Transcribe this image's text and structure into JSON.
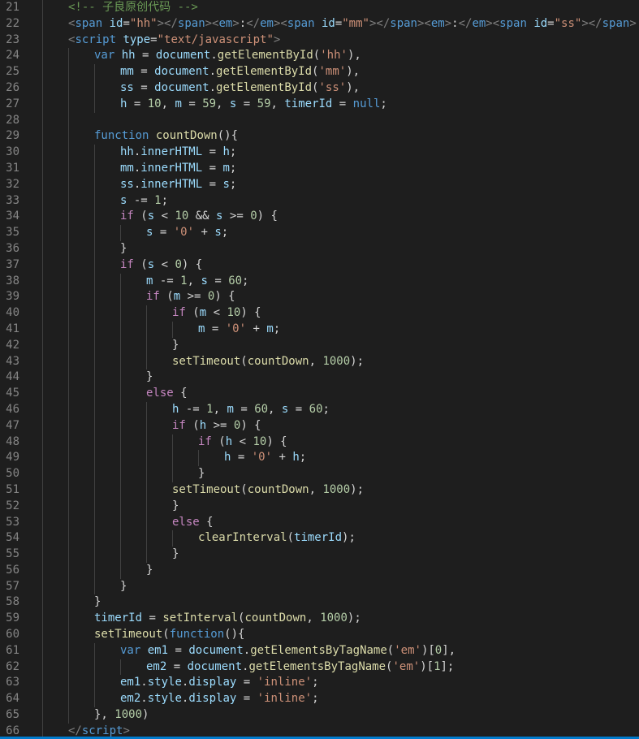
{
  "colors": {
    "plain": "#d4d4d4",
    "keyword": "#569cd6",
    "control": "#c586c0",
    "identifier": "#9cdcfe",
    "function": "#dcdcaa",
    "string": "#ce9178",
    "number": "#b5cea8",
    "comment": "#6a9955",
    "tag": "#569cd6",
    "bracket": "#808080",
    "attr": "#9cdcfe"
  },
  "lines": [
    {
      "n": "21",
      "indent": 1,
      "tokens": [
        [
          "comment",
          "<!-- 子良原创代码 -->"
        ]
      ]
    },
    {
      "n": "22",
      "indent": 1,
      "tokens": [
        [
          "bracket",
          "<"
        ],
        [
          "tag",
          "span"
        ],
        [
          "plain",
          " "
        ],
        [
          "attr",
          "id"
        ],
        [
          "plain",
          "="
        ],
        [
          "string",
          "\"hh\""
        ],
        [
          "bracket",
          "></"
        ],
        [
          "tag",
          "span"
        ],
        [
          "bracket",
          "><"
        ],
        [
          "tag",
          "em"
        ],
        [
          "bracket",
          ">"
        ],
        [
          "plain",
          ":"
        ],
        [
          "bracket",
          "</"
        ],
        [
          "tag",
          "em"
        ],
        [
          "bracket",
          "><"
        ],
        [
          "tag",
          "span"
        ],
        [
          "plain",
          " "
        ],
        [
          "attr",
          "id"
        ],
        [
          "plain",
          "="
        ],
        [
          "string",
          "\"mm\""
        ],
        [
          "bracket",
          "></"
        ],
        [
          "tag",
          "span"
        ],
        [
          "bracket",
          "><"
        ],
        [
          "tag",
          "em"
        ],
        [
          "bracket",
          ">"
        ],
        [
          "plain",
          ":"
        ],
        [
          "bracket",
          "</"
        ],
        [
          "tag",
          "em"
        ],
        [
          "bracket",
          "><"
        ],
        [
          "tag",
          "span"
        ],
        [
          "plain",
          " "
        ],
        [
          "attr",
          "id"
        ],
        [
          "plain",
          "="
        ],
        [
          "string",
          "\"ss\""
        ],
        [
          "bracket",
          "></"
        ],
        [
          "tag",
          "span"
        ],
        [
          "bracket",
          ">"
        ]
      ]
    },
    {
      "n": "23",
      "indent": 1,
      "tokens": [
        [
          "bracket",
          "<"
        ],
        [
          "tag",
          "script"
        ],
        [
          "plain",
          " "
        ],
        [
          "attr",
          "type"
        ],
        [
          "plain",
          "="
        ],
        [
          "string",
          "\"text/javascript\""
        ],
        [
          "bracket",
          ">"
        ]
      ]
    },
    {
      "n": "24",
      "indent": 2,
      "tokens": [
        [
          "keyword",
          "var"
        ],
        [
          "plain",
          " "
        ],
        [
          "identifier",
          "hh"
        ],
        [
          "plain",
          " = "
        ],
        [
          "identifier",
          "document"
        ],
        [
          "plain",
          "."
        ],
        [
          "function",
          "getElementById"
        ],
        [
          "plain",
          "("
        ],
        [
          "string",
          "'hh'"
        ],
        [
          "plain",
          "),"
        ]
      ]
    },
    {
      "n": "25",
      "indent": 3,
      "tokens": [
        [
          "identifier",
          "mm"
        ],
        [
          "plain",
          " = "
        ],
        [
          "identifier",
          "document"
        ],
        [
          "plain",
          "."
        ],
        [
          "function",
          "getElementById"
        ],
        [
          "plain",
          "("
        ],
        [
          "string",
          "'mm'"
        ],
        [
          "plain",
          "),"
        ]
      ]
    },
    {
      "n": "26",
      "indent": 3,
      "tokens": [
        [
          "identifier",
          "ss"
        ],
        [
          "plain",
          " = "
        ],
        [
          "identifier",
          "document"
        ],
        [
          "plain",
          "."
        ],
        [
          "function",
          "getElementById"
        ],
        [
          "plain",
          "("
        ],
        [
          "string",
          "'ss'"
        ],
        [
          "plain",
          "),"
        ]
      ]
    },
    {
      "n": "27",
      "indent": 3,
      "tokens": [
        [
          "identifier",
          "h"
        ],
        [
          "plain",
          " = "
        ],
        [
          "number",
          "10"
        ],
        [
          "plain",
          ", "
        ],
        [
          "identifier",
          "m"
        ],
        [
          "plain",
          " = "
        ],
        [
          "number",
          "59"
        ],
        [
          "plain",
          ", "
        ],
        [
          "identifier",
          "s"
        ],
        [
          "plain",
          " = "
        ],
        [
          "number",
          "59"
        ],
        [
          "plain",
          ", "
        ],
        [
          "identifier",
          "timerId"
        ],
        [
          "plain",
          " = "
        ],
        [
          "keyword",
          "null"
        ],
        [
          "plain",
          ";"
        ]
      ]
    },
    {
      "n": "28",
      "indent": 2,
      "tokens": []
    },
    {
      "n": "29",
      "indent": 2,
      "tokens": [
        [
          "keyword",
          "function"
        ],
        [
          "plain",
          " "
        ],
        [
          "function",
          "countDown"
        ],
        [
          "plain",
          "(){"
        ]
      ]
    },
    {
      "n": "30",
      "indent": 3,
      "tokens": [
        [
          "identifier",
          "hh"
        ],
        [
          "plain",
          "."
        ],
        [
          "identifier",
          "innerHTML"
        ],
        [
          "plain",
          " = "
        ],
        [
          "identifier",
          "h"
        ],
        [
          "plain",
          ";"
        ]
      ]
    },
    {
      "n": "31",
      "indent": 3,
      "tokens": [
        [
          "identifier",
          "mm"
        ],
        [
          "plain",
          "."
        ],
        [
          "identifier",
          "innerHTML"
        ],
        [
          "plain",
          " = "
        ],
        [
          "identifier",
          "m"
        ],
        [
          "plain",
          ";"
        ]
      ]
    },
    {
      "n": "32",
      "indent": 3,
      "tokens": [
        [
          "identifier",
          "ss"
        ],
        [
          "plain",
          "."
        ],
        [
          "identifier",
          "innerHTML"
        ],
        [
          "plain",
          " = "
        ],
        [
          "identifier",
          "s"
        ],
        [
          "plain",
          ";"
        ]
      ]
    },
    {
      "n": "33",
      "indent": 3,
      "tokens": [
        [
          "identifier",
          "s"
        ],
        [
          "plain",
          " -= "
        ],
        [
          "number",
          "1"
        ],
        [
          "plain",
          ";"
        ]
      ]
    },
    {
      "n": "34",
      "indent": 3,
      "tokens": [
        [
          "control",
          "if"
        ],
        [
          "plain",
          " ("
        ],
        [
          "identifier",
          "s"
        ],
        [
          "plain",
          " < "
        ],
        [
          "number",
          "10"
        ],
        [
          "plain",
          " && "
        ],
        [
          "identifier",
          "s"
        ],
        [
          "plain",
          " >= "
        ],
        [
          "number",
          "0"
        ],
        [
          "plain",
          ") {"
        ]
      ]
    },
    {
      "n": "35",
      "indent": 4,
      "tokens": [
        [
          "identifier",
          "s"
        ],
        [
          "plain",
          " = "
        ],
        [
          "string",
          "'0'"
        ],
        [
          "plain",
          " + "
        ],
        [
          "identifier",
          "s"
        ],
        [
          "plain",
          ";"
        ]
      ]
    },
    {
      "n": "36",
      "indent": 3,
      "tokens": [
        [
          "plain",
          "}"
        ]
      ]
    },
    {
      "n": "37",
      "indent": 3,
      "tokens": [
        [
          "control",
          "if"
        ],
        [
          "plain",
          " ("
        ],
        [
          "identifier",
          "s"
        ],
        [
          "plain",
          " < "
        ],
        [
          "number",
          "0"
        ],
        [
          "plain",
          ") {"
        ]
      ]
    },
    {
      "n": "38",
      "indent": 4,
      "tokens": [
        [
          "identifier",
          "m"
        ],
        [
          "plain",
          " -= "
        ],
        [
          "number",
          "1"
        ],
        [
          "plain",
          ", "
        ],
        [
          "identifier",
          "s"
        ],
        [
          "plain",
          " = "
        ],
        [
          "number",
          "60"
        ],
        [
          "plain",
          ";"
        ]
      ]
    },
    {
      "n": "39",
      "indent": 4,
      "tokens": [
        [
          "control",
          "if"
        ],
        [
          "plain",
          " ("
        ],
        [
          "identifier",
          "m"
        ],
        [
          "plain",
          " >= "
        ],
        [
          "number",
          "0"
        ],
        [
          "plain",
          ") {"
        ]
      ]
    },
    {
      "n": "40",
      "indent": 5,
      "tokens": [
        [
          "control",
          "if"
        ],
        [
          "plain",
          " ("
        ],
        [
          "identifier",
          "m"
        ],
        [
          "plain",
          " < "
        ],
        [
          "number",
          "10"
        ],
        [
          "plain",
          ") {"
        ]
      ]
    },
    {
      "n": "41",
      "indent": 6,
      "tokens": [
        [
          "identifier",
          "m"
        ],
        [
          "plain",
          " = "
        ],
        [
          "string",
          "'0'"
        ],
        [
          "plain",
          " + "
        ],
        [
          "identifier",
          "m"
        ],
        [
          "plain",
          ";"
        ]
      ]
    },
    {
      "n": "42",
      "indent": 5,
      "tokens": [
        [
          "plain",
          "}"
        ]
      ]
    },
    {
      "n": "43",
      "indent": 5,
      "tokens": [
        [
          "function",
          "setTimeout"
        ],
        [
          "plain",
          "("
        ],
        [
          "function",
          "countDown"
        ],
        [
          "plain",
          ", "
        ],
        [
          "number",
          "1000"
        ],
        [
          "plain",
          ");"
        ]
      ]
    },
    {
      "n": "44",
      "indent": 4,
      "tokens": [
        [
          "plain",
          "}"
        ]
      ]
    },
    {
      "n": "45",
      "indent": 4,
      "tokens": [
        [
          "control",
          "else"
        ],
        [
          "plain",
          " {"
        ]
      ]
    },
    {
      "n": "46",
      "indent": 5,
      "tokens": [
        [
          "identifier",
          "h"
        ],
        [
          "plain",
          " -= "
        ],
        [
          "number",
          "1"
        ],
        [
          "plain",
          ", "
        ],
        [
          "identifier",
          "m"
        ],
        [
          "plain",
          " = "
        ],
        [
          "number",
          "60"
        ],
        [
          "plain",
          ", "
        ],
        [
          "identifier",
          "s"
        ],
        [
          "plain",
          " = "
        ],
        [
          "number",
          "60"
        ],
        [
          "plain",
          ";"
        ]
      ]
    },
    {
      "n": "47",
      "indent": 5,
      "tokens": [
        [
          "control",
          "if"
        ],
        [
          "plain",
          " ("
        ],
        [
          "identifier",
          "h"
        ],
        [
          "plain",
          " >= "
        ],
        [
          "number",
          "0"
        ],
        [
          "plain",
          ") {"
        ]
      ]
    },
    {
      "n": "48",
      "indent": 6,
      "tokens": [
        [
          "control",
          "if"
        ],
        [
          "plain",
          " ("
        ],
        [
          "identifier",
          "h"
        ],
        [
          "plain",
          " < "
        ],
        [
          "number",
          "10"
        ],
        [
          "plain",
          ") {"
        ]
      ]
    },
    {
      "n": "49",
      "indent": 7,
      "tokens": [
        [
          "identifier",
          "h"
        ],
        [
          "plain",
          " = "
        ],
        [
          "string",
          "'0'"
        ],
        [
          "plain",
          " + "
        ],
        [
          "identifier",
          "h"
        ],
        [
          "plain",
          ";"
        ]
      ]
    },
    {
      "n": "50",
      "indent": 6,
      "tokens": [
        [
          "plain",
          "}"
        ]
      ]
    },
    {
      "n": "51",
      "indent": 5,
      "tokens": [
        [
          "function",
          "setTimeout"
        ],
        [
          "plain",
          "("
        ],
        [
          "function",
          "countDown"
        ],
        [
          "plain",
          ", "
        ],
        [
          "number",
          "1000"
        ],
        [
          "plain",
          ");"
        ]
      ]
    },
    {
      "n": "52",
      "indent": 5,
      "tokens": [
        [
          "plain",
          "}"
        ]
      ]
    },
    {
      "n": "53",
      "indent": 5,
      "tokens": [
        [
          "control",
          "else"
        ],
        [
          "plain",
          " {"
        ]
      ]
    },
    {
      "n": "54",
      "indent": 6,
      "tokens": [
        [
          "function",
          "clearInterval"
        ],
        [
          "plain",
          "("
        ],
        [
          "identifier",
          "timerId"
        ],
        [
          "plain",
          ");"
        ]
      ]
    },
    {
      "n": "55",
      "indent": 5,
      "tokens": [
        [
          "plain",
          "}"
        ]
      ]
    },
    {
      "n": "56",
      "indent": 4,
      "tokens": [
        [
          "plain",
          "}"
        ]
      ]
    },
    {
      "n": "57",
      "indent": 3,
      "tokens": [
        [
          "plain",
          "}"
        ]
      ]
    },
    {
      "n": "58",
      "indent": 2,
      "tokens": [
        [
          "plain",
          "}"
        ]
      ]
    },
    {
      "n": "59",
      "indent": 2,
      "tokens": [
        [
          "identifier",
          "timerId"
        ],
        [
          "plain",
          " = "
        ],
        [
          "function",
          "setInterval"
        ],
        [
          "plain",
          "("
        ],
        [
          "function",
          "countDown"
        ],
        [
          "plain",
          ", "
        ],
        [
          "number",
          "1000"
        ],
        [
          "plain",
          ");"
        ]
      ]
    },
    {
      "n": "60",
      "indent": 2,
      "tokens": [
        [
          "function",
          "setTimeout"
        ],
        [
          "plain",
          "("
        ],
        [
          "keyword",
          "function"
        ],
        [
          "plain",
          "(){"
        ]
      ]
    },
    {
      "n": "61",
      "indent": 3,
      "tokens": [
        [
          "keyword",
          "var"
        ],
        [
          "plain",
          " "
        ],
        [
          "identifier",
          "em1"
        ],
        [
          "plain",
          " = "
        ],
        [
          "identifier",
          "document"
        ],
        [
          "plain",
          "."
        ],
        [
          "function",
          "getElementsByTagName"
        ],
        [
          "plain",
          "("
        ],
        [
          "string",
          "'em'"
        ],
        [
          "plain",
          ")["
        ],
        [
          "number",
          "0"
        ],
        [
          "plain",
          "],"
        ]
      ]
    },
    {
      "n": "62",
      "indent": 4,
      "tokens": [
        [
          "identifier",
          "em2"
        ],
        [
          "plain",
          " = "
        ],
        [
          "identifier",
          "document"
        ],
        [
          "plain",
          "."
        ],
        [
          "function",
          "getElementsByTagName"
        ],
        [
          "plain",
          "("
        ],
        [
          "string",
          "'em'"
        ],
        [
          "plain",
          ")["
        ],
        [
          "number",
          "1"
        ],
        [
          "plain",
          "];"
        ]
      ]
    },
    {
      "n": "63",
      "indent": 3,
      "tokens": [
        [
          "identifier",
          "em1"
        ],
        [
          "plain",
          "."
        ],
        [
          "identifier",
          "style"
        ],
        [
          "plain",
          "."
        ],
        [
          "identifier",
          "display"
        ],
        [
          "plain",
          " = "
        ],
        [
          "string",
          "'inline'"
        ],
        [
          "plain",
          ";"
        ]
      ]
    },
    {
      "n": "64",
      "indent": 3,
      "tokens": [
        [
          "identifier",
          "em2"
        ],
        [
          "plain",
          "."
        ],
        [
          "identifier",
          "style"
        ],
        [
          "plain",
          "."
        ],
        [
          "identifier",
          "display"
        ],
        [
          "plain",
          " = "
        ],
        [
          "string",
          "'inline'"
        ],
        [
          "plain",
          ";"
        ]
      ]
    },
    {
      "n": "65",
      "indent": 2,
      "tokens": [
        [
          "plain",
          "}, "
        ],
        [
          "number",
          "1000"
        ],
        [
          "plain",
          ")"
        ]
      ]
    },
    {
      "n": "66",
      "indent": 1,
      "tokens": [
        [
          "bracket",
          "</"
        ],
        [
          "tag",
          "script"
        ],
        [
          "bracket",
          ">"
        ]
      ]
    }
  ]
}
